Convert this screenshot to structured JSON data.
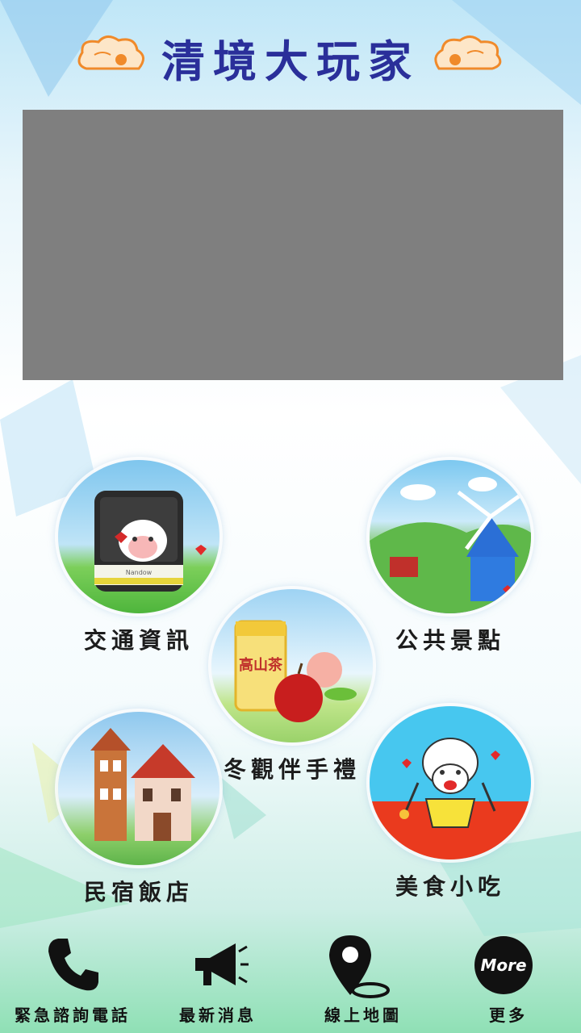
{
  "header": {
    "title": "清境大玩家"
  },
  "tiles": [
    {
      "label": "交通資訊"
    },
    {
      "label": "公共景點"
    },
    {
      "label": "冬觀伴手禮"
    },
    {
      "label": "民宿飯店"
    },
    {
      "label": "美食小吃"
    }
  ],
  "illustration": {
    "bus_brand": "Nandow",
    "tea_can_text": "高山茶"
  },
  "nav": {
    "emergency_label": "緊急諮詢電話",
    "news_label": "最新消息",
    "map_label": "線上地圖",
    "more_label": "更多",
    "more_button_text": "More"
  },
  "colors": {
    "title": "#2a2f9a",
    "banner": "#7f7f7f",
    "nav_icon": "#111111"
  }
}
